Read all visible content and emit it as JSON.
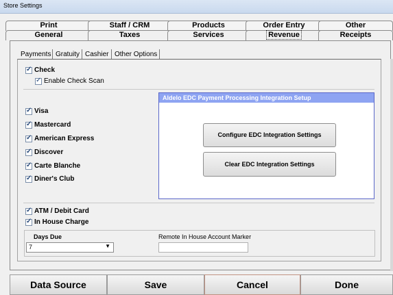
{
  "window": {
    "title": "Store Settings"
  },
  "tabs_top": [
    {
      "label": "Print"
    },
    {
      "label": "Staff / CRM"
    },
    {
      "label": "Products"
    },
    {
      "label": "Order Entry"
    },
    {
      "label": "Other"
    }
  ],
  "tabs_bottom": [
    {
      "label": "General"
    },
    {
      "label": "Taxes"
    },
    {
      "label": "Services"
    },
    {
      "label": "Revenue",
      "selected": true
    },
    {
      "label": "Receipts"
    }
  ],
  "subtabs": [
    {
      "label": "Payments",
      "selected": true
    },
    {
      "label": "Gratuity"
    },
    {
      "label": "Cashier"
    },
    {
      "label": "Other Options"
    }
  ],
  "payments": {
    "check": {
      "label": "Check",
      "checked": true
    },
    "enable_check_scan": {
      "label": "Enable Check Scan",
      "checked": true
    },
    "cards": [
      {
        "label": "Visa",
        "checked": true
      },
      {
        "label": "Mastercard",
        "checked": true
      },
      {
        "label": "American Express",
        "checked": true
      },
      {
        "label": "Discover",
        "checked": true
      },
      {
        "label": "Carte Blanche",
        "checked": true
      },
      {
        "label": "Diner's Club",
        "checked": true
      }
    ],
    "atm": {
      "label": "ATM / Debit Card",
      "checked": true
    },
    "in_house": {
      "label": "In House Charge",
      "checked": true
    }
  },
  "edc": {
    "title": "Aldelo EDC Payment Processing Integration Setup",
    "configure_label": "Configure EDC Integration Settings",
    "clear_label": "Clear EDC Integration Settings"
  },
  "days_due": {
    "label": "Days Due",
    "value": "7"
  },
  "remote_marker": {
    "label": "Remote In House Account Marker",
    "value": ""
  },
  "footer": {
    "data_source": "Data Source",
    "save": "Save",
    "cancel": "Cancel",
    "done": "Done"
  },
  "colors": {
    "edc_header": "#8ea4f2",
    "edc_border": "#5a66c8"
  }
}
